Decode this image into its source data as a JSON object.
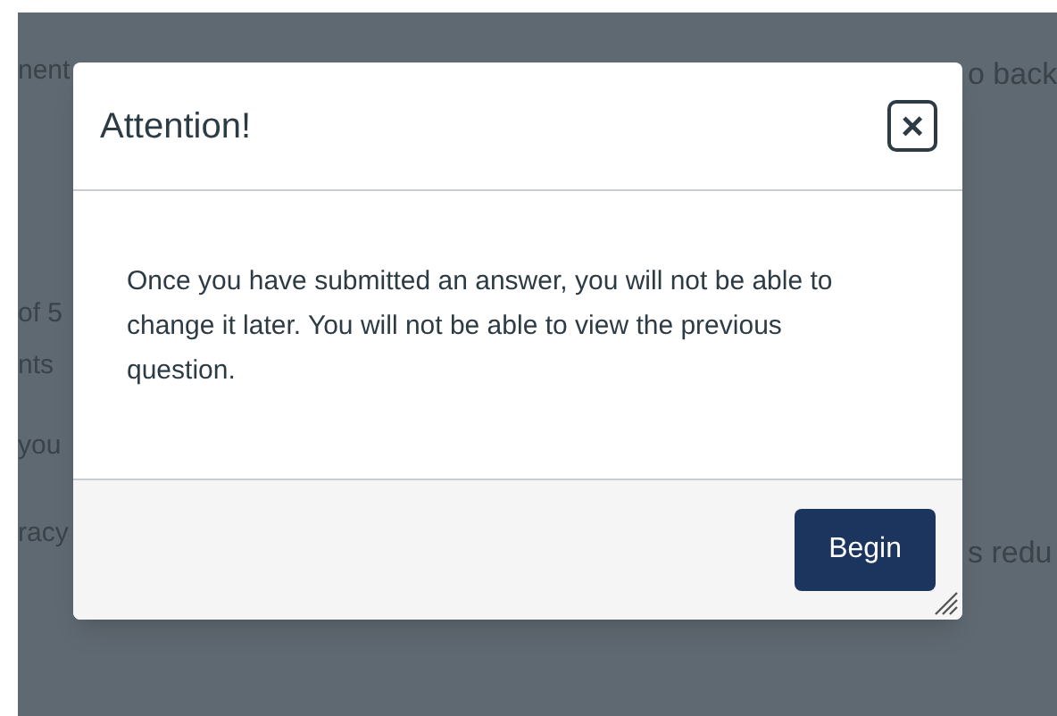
{
  "background_text": {
    "left": [
      {
        "text": "nent"
      },
      {
        "text": "of 5"
      },
      {
        "text": "nts"
      },
      {
        "text": "you"
      },
      {
        "text": "racy"
      }
    ],
    "right": [
      {
        "text": "o back"
      },
      {
        "text": "s redu"
      }
    ]
  },
  "dialog": {
    "title": "Attention!",
    "close_label": "×",
    "message": "Once you have submitted an answer, you will not be able to change it later. You will not be able to view the previous question.",
    "buttons": [
      "Begin"
    ]
  }
}
